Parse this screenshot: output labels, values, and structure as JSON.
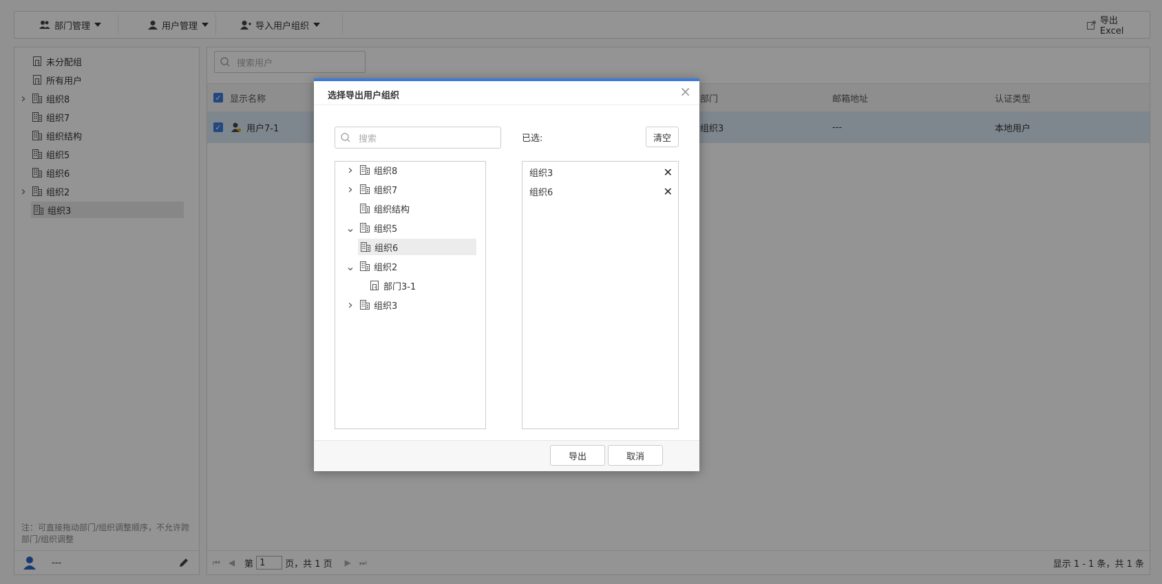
{
  "toolbar": {
    "dept_manage": "部门管理",
    "user_manage": "用户管理",
    "import_org": "导入用户组织",
    "export_excel": "导出Excel"
  },
  "left_tree": {
    "items": [
      {
        "label": "未分配组",
        "icon": "dept-icon",
        "expandable": false
      },
      {
        "label": "所有用户",
        "icon": "dept-icon",
        "expandable": false
      },
      {
        "label": "组织8",
        "icon": "org-icon",
        "expandable": true
      },
      {
        "label": "组织7",
        "icon": "org-icon",
        "expandable": false
      },
      {
        "label": "组织结构",
        "icon": "org-icon",
        "expandable": false
      },
      {
        "label": "组织5",
        "icon": "org-icon",
        "expandable": false
      },
      {
        "label": "组织6",
        "icon": "org-icon",
        "expandable": false
      },
      {
        "label": "组织2",
        "icon": "org-icon",
        "expandable": true
      },
      {
        "label": "组织3",
        "icon": "org-icon",
        "expandable": false,
        "selected": true
      }
    ],
    "note": "注：可直接拖动部门/组织调整顺序，不允许跨部门/组织调整",
    "footer_user": "---"
  },
  "search": {
    "placeholder": "搜索用户"
  },
  "grid": {
    "columns": [
      "显示名称",
      "部门",
      "邮箱地址",
      "认证类型"
    ],
    "rows": [
      {
        "name": "用户7-1",
        "dept": "组织3",
        "email": "---",
        "auth": "本地用户"
      }
    ]
  },
  "pager": {
    "page_prefix": "第",
    "page_value": "1",
    "page_suffix": "页，共 1 页",
    "summary": "显示 1 - 1 条，共 1 条"
  },
  "modal": {
    "title": "选择导出用户组织",
    "search_placeholder": "搜索",
    "selected_label": "已选:",
    "clear_label": "清空",
    "tree": [
      {
        "label": "组织8",
        "arrow": "right"
      },
      {
        "label": "组织7",
        "arrow": "right"
      },
      {
        "label": "组织结构",
        "arrow": "none"
      },
      {
        "label": "组织5",
        "arrow": "down"
      },
      {
        "label": "组织6",
        "arrow": "none",
        "selected": true,
        "child": true
      },
      {
        "label": "组织2",
        "arrow": "down"
      },
      {
        "label": "部门3-1",
        "arrow": "none",
        "child": true,
        "dept": true
      },
      {
        "label": "组织3",
        "arrow": "right"
      }
    ],
    "selected": [
      "组织3",
      "组织6"
    ],
    "export_label": "导出",
    "cancel_label": "取消"
  },
  "colors": {
    "accent": "#3d7bd9",
    "row_selected": "#dbe8f5"
  }
}
